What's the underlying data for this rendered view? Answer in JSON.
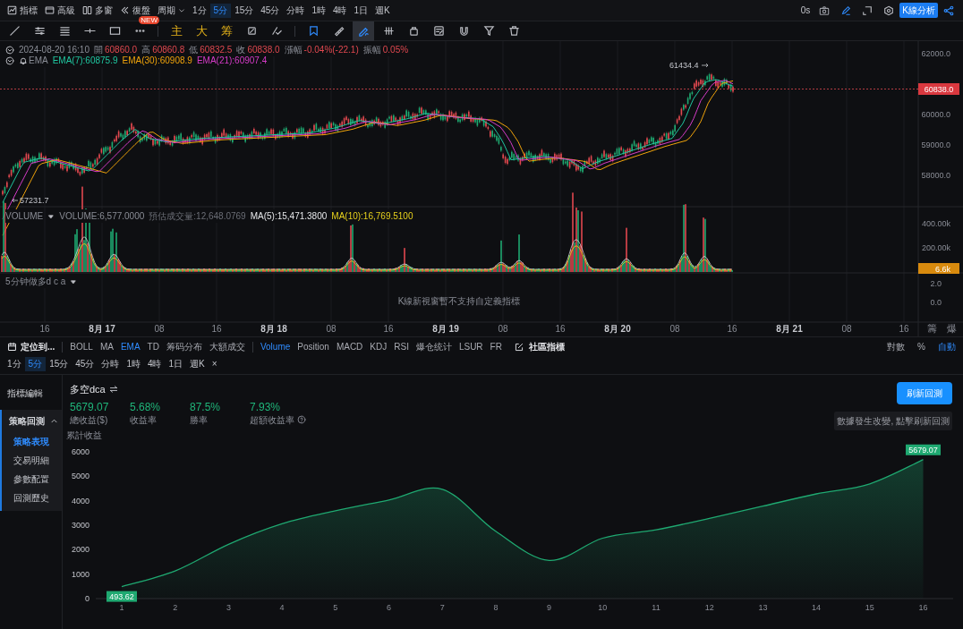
{
  "top_toolbar": {
    "menus": [
      {
        "label": "指標"
      },
      {
        "label": "高級"
      },
      {
        "label": "多窗"
      },
      {
        "label": "復盤"
      }
    ],
    "period_menu": "周期",
    "periods": [
      {
        "label": "1分",
        "selected": false
      },
      {
        "label": "5分",
        "selected": true
      },
      {
        "label": "15分",
        "selected": false
      },
      {
        "label": "45分",
        "selected": false
      },
      {
        "label": "分時",
        "selected": false
      },
      {
        "label": "1時",
        "selected": false
      },
      {
        "label": "4時",
        "selected": false
      },
      {
        "label": "1日",
        "selected": false
      },
      {
        "label": "週K",
        "selected": false
      }
    ],
    "timer": "0s",
    "analysis_button": "K線分析"
  },
  "drawing_tools": [
    {
      "kind": "icon",
      "selected": false
    },
    {
      "kind": "icon",
      "selected": false
    },
    {
      "kind": "icon",
      "selected": false
    },
    {
      "kind": "icon",
      "selected": false
    },
    {
      "kind": "icon",
      "selected": false
    },
    {
      "kind": "icon",
      "selected": false,
      "badge": "NEW"
    },
    {
      "kind": "glyph",
      "label": "主",
      "selected": false
    },
    {
      "kind": "glyph",
      "label": "大",
      "selected": false
    },
    {
      "kind": "glyph",
      "label": "筹",
      "selected": false
    },
    {
      "kind": "icon",
      "selected": false
    },
    {
      "kind": "icon",
      "selected": false
    },
    {
      "kind": "icon",
      "selected": false
    },
    {
      "kind": "icon",
      "selected": false
    },
    {
      "kind": "icon",
      "selected": true
    },
    {
      "kind": "icon",
      "selected": false
    },
    {
      "kind": "icon",
      "selected": false
    },
    {
      "kind": "icon",
      "selected": false
    },
    {
      "kind": "icon",
      "selected": false
    },
    {
      "kind": "icon",
      "selected": false
    },
    {
      "kind": "icon",
      "selected": false
    }
  ],
  "price_legend": {
    "datetime": "2024-08-20 16:10",
    "items": [
      {
        "label": "開",
        "value": "60860.0"
      },
      {
        "label": "高",
        "value": "60860.8"
      },
      {
        "label": "低",
        "value": "60832.5"
      },
      {
        "label": "收",
        "value": "60838.0"
      },
      {
        "label": "漲幅",
        "value": "-0.04%(-22.1)"
      },
      {
        "label": "振幅",
        "value": "0.05%"
      }
    ]
  },
  "ema_legend": {
    "name": "EMA",
    "items": [
      {
        "text": "EMA(7):60875.9",
        "color": "#1fc7a0"
      },
      {
        "text": "EMA(30):60908.9",
        "color": "#f0a30a"
      },
      {
        "text": "EMA(21):60907.4",
        "color": "#d63bc8"
      }
    ]
  },
  "price_axis": {
    "ticks": [
      "62000.0",
      "60000.0",
      "59000.0",
      "58000.0"
    ],
    "current_price": "60838.0",
    "high_marker": "61434.4",
    "low_marker": "57231.7"
  },
  "volume_pane": {
    "title": "VOLUME",
    "items": [
      {
        "text": "VOLUME:6,577.0000",
        "color": "#8a8d96"
      },
      {
        "text": "預估成交量:12,648.0769",
        "color": "#6b6e76"
      },
      {
        "text": "MA(5):15,471.3800",
        "color": "#e6e7ea"
      },
      {
        "text": "MA(10):16,769.5100",
        "color": "#e8d21d"
      }
    ],
    "ticks": [
      "400.00k",
      "200.00k"
    ],
    "current": "6.6k"
  },
  "indicator_pane": {
    "title": "5分钟做多d c a",
    "message": "K線新視窗暫不支持自定義指標",
    "ticks": [
      "2.0",
      "0.0"
    ]
  },
  "time_axis": {
    "labels": [
      {
        "text": "16",
        "kind": "hour"
      },
      {
        "text": "8月 17",
        "kind": "date"
      },
      {
        "text": "08",
        "kind": "hour"
      },
      {
        "text": "16",
        "kind": "hour"
      },
      {
        "text": "8月 18",
        "kind": "date"
      },
      {
        "text": "08",
        "kind": "hour"
      },
      {
        "text": "16",
        "kind": "hour"
      },
      {
        "text": "8月 19",
        "kind": "date"
      },
      {
        "text": "08",
        "kind": "hour"
      },
      {
        "text": "16",
        "kind": "hour"
      },
      {
        "text": "8月 20",
        "kind": "date"
      },
      {
        "text": "08",
        "kind": "hour"
      },
      {
        "text": "16",
        "kind": "hour"
      },
      {
        "text": "8月 21",
        "kind": "date"
      },
      {
        "text": "08",
        "kind": "hour"
      },
      {
        "text": "16",
        "kind": "hour"
      }
    ],
    "corner": [
      "籌",
      "爆"
    ]
  },
  "indicator_bar": {
    "locate": "定位到...",
    "main": [
      {
        "label": "BOLL",
        "selected": false
      },
      {
        "label": "MA",
        "selected": false
      },
      {
        "label": "EMA",
        "selected": true
      },
      {
        "label": "TD",
        "selected": false
      },
      {
        "label": "筹码分布",
        "selected": false
      },
      {
        "label": "大額成交",
        "selected": false
      }
    ],
    "sub": [
      {
        "label": "Volume",
        "selected": true
      },
      {
        "label": "Position",
        "selected": false
      },
      {
        "label": "MACD",
        "selected": false
      },
      {
        "label": "KDJ",
        "selected": false
      },
      {
        "label": "RSI",
        "selected": false
      },
      {
        "label": "爆仓统计",
        "selected": false
      },
      {
        "label": "LSUR",
        "selected": false
      },
      {
        "label": "FR",
        "selected": false
      }
    ],
    "community": "社區指標",
    "scale": [
      {
        "label": "對數",
        "selected": false
      },
      {
        "label": "%",
        "selected": false
      },
      {
        "label": "自動",
        "selected": true
      }
    ]
  },
  "period_row": {
    "periods": [
      {
        "label": "1分",
        "selected": false
      },
      {
        "label": "5分",
        "selected": true
      },
      {
        "label": "15分",
        "selected": false
      },
      {
        "label": "45分",
        "selected": false
      },
      {
        "label": "分時",
        "selected": false
      },
      {
        "label": "1時",
        "selected": false
      },
      {
        "label": "4時",
        "selected": false
      },
      {
        "label": "1日",
        "selected": false
      },
      {
        "label": "週K",
        "selected": false
      }
    ],
    "close": "×"
  },
  "sidebar": {
    "items": [
      {
        "label": "指標編輯"
      },
      {
        "label": "策略回測",
        "expanded": true,
        "children": [
          {
            "label": "策略表現",
            "selected": true
          },
          {
            "label": "交易明細",
            "selected": false
          },
          {
            "label": "參數配置",
            "selected": false
          },
          {
            "label": "回測歷史",
            "selected": false
          }
        ]
      }
    ]
  },
  "strategy": {
    "title": "多空dca",
    "stats": [
      {
        "value": "5679.07",
        "label": "總收益($)",
        "help": false
      },
      {
        "value": "5.68%",
        "label": "收益率",
        "help": false
      },
      {
        "value": "87.5%",
        "label": "勝率",
        "help": false
      },
      {
        "value": "7.93%",
        "label": "超額收益率",
        "help": true
      }
    ],
    "refresh_button": "刷新回測",
    "notice": "數據發生改變, 點擊刷新回測",
    "chart_data": {
      "type": "area",
      "ylabel": "累計收益",
      "categories": [
        "1",
        "2",
        "3",
        "4",
        "5",
        "6",
        "7",
        "8",
        "9",
        "10",
        "11",
        "12",
        "13",
        "14",
        "15",
        "16"
      ],
      "series": [
        {
          "color": "#1fa971",
          "values": [
            490,
            1130,
            2220,
            3060,
            3590,
            4030,
            4470,
            2750,
            1560,
            2470,
            2810,
            3280,
            3780,
            4280,
            4690,
            5680
          ]
        }
      ],
      "ylim": [
        0,
        6000
      ],
      "yticks": [
        0,
        1000,
        2000,
        3000,
        4000,
        5000,
        6000
      ],
      "annotations": [
        "493.62",
        "5679.07"
      ]
    }
  }
}
